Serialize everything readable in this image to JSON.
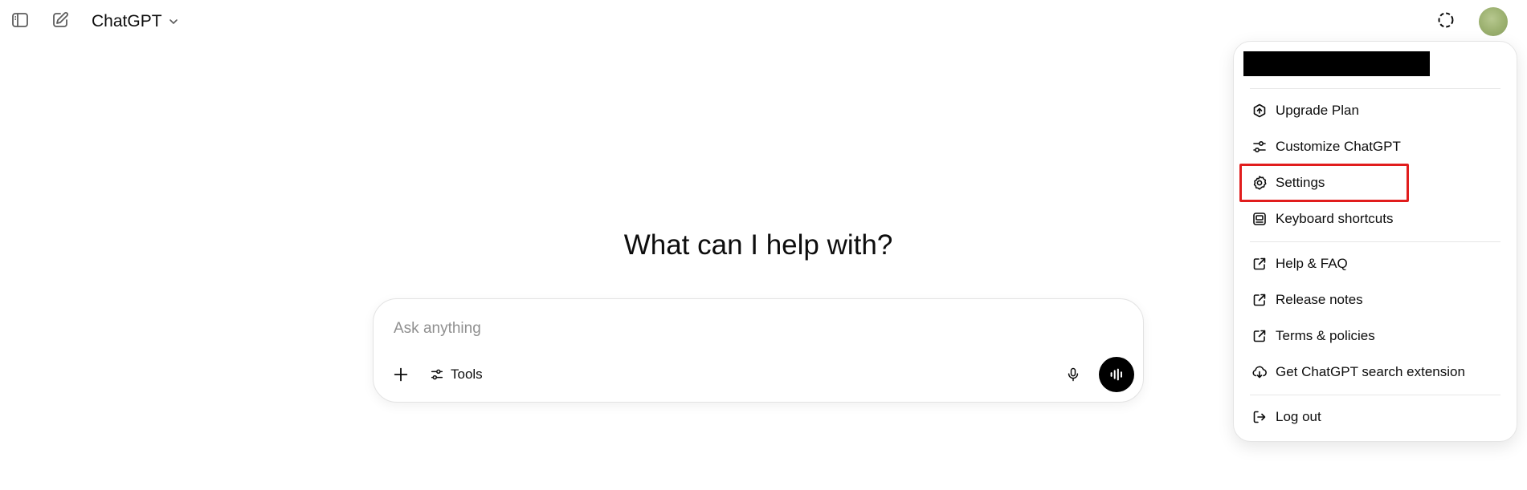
{
  "header": {
    "app_name": "ChatGPT",
    "icons": {
      "sidebar": "sidebar-toggle-icon",
      "new_chat": "new-chat-icon",
      "model_chevron": "chevron-down-icon",
      "temporary_chat": "temporary-chat-icon"
    }
  },
  "main": {
    "headline": "What can I help with?",
    "composer": {
      "placeholder": "Ask anything",
      "tools_label": "Tools"
    }
  },
  "account_menu": {
    "items": [
      {
        "label": "Upgrade Plan",
        "icon": "upgrade-icon"
      },
      {
        "label": "Customize ChatGPT",
        "icon": "customize-icon"
      },
      {
        "label": "Settings",
        "icon": "gear-icon",
        "highlighted": true
      },
      {
        "label": "Keyboard shortcuts",
        "icon": "keyboard-icon"
      },
      {
        "label": "Help & FAQ",
        "icon": "external-link-icon"
      },
      {
        "label": "Release notes",
        "icon": "external-link-icon"
      },
      {
        "label": "Terms & policies",
        "icon": "external-link-icon"
      },
      {
        "label": "Get ChatGPT search extension",
        "icon": "extension-icon"
      },
      {
        "label": "Log out",
        "icon": "logout-icon"
      }
    ]
  },
  "colors": {
    "highlight_border": "#e11d1d",
    "voice_button": "#000000",
    "text": "#0d0d0d",
    "placeholder": "#8f8f8f"
  }
}
